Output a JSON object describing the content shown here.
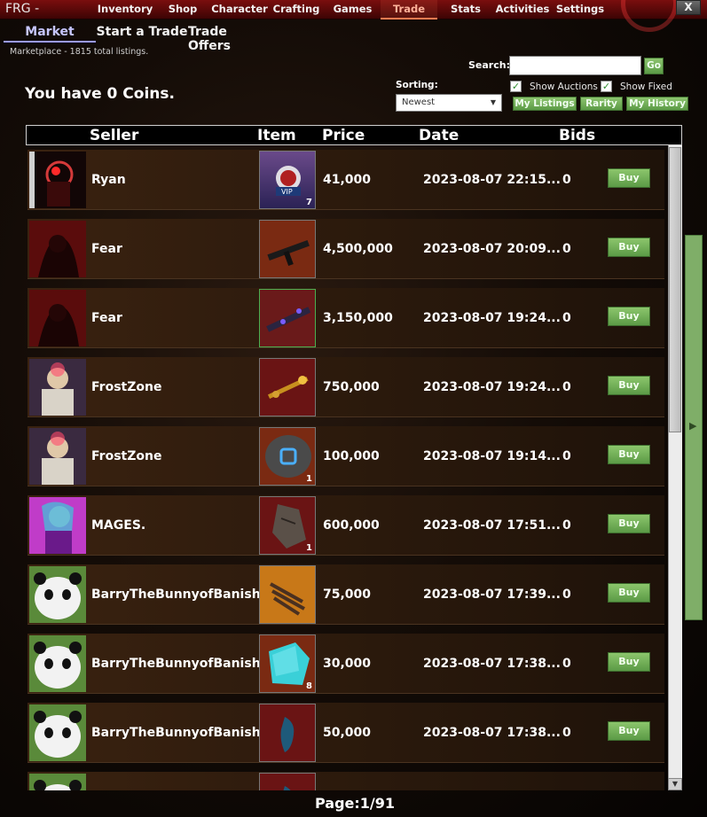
{
  "app": {
    "title": "FRG -",
    "close_label": "X"
  },
  "nav": {
    "items": [
      "Inventory",
      "Shop",
      "Character",
      "Crafting",
      "Games",
      "Trade",
      "Stats",
      "Activities",
      "Settings"
    ],
    "active": "Trade"
  },
  "subtabs": {
    "items": [
      "Market",
      "Start a Trade",
      "Trade Offers"
    ],
    "active": "Market"
  },
  "marketplace_info": "Marketplace - 1815 total listings.",
  "coins_text": "You have 0 Coins.",
  "search": {
    "label": "Search:",
    "value": "",
    "go_label": "Go"
  },
  "sorting": {
    "label": "Sorting:",
    "selected": "Newest"
  },
  "filters": {
    "show_auctions": "Show Auctions",
    "show_fixed": "Show Fixed",
    "show_auctions_checked": true,
    "show_fixed_checked": true
  },
  "buttons": {
    "my_listings": "My Listings",
    "rarity": "Rarity",
    "my_history": "My History"
  },
  "table": {
    "headers": {
      "seller": "Seller",
      "item": "Item",
      "price": "Price",
      "date": "Date",
      "bids": "Bids"
    },
    "buy_label": "Buy",
    "rows": [
      {
        "seller": "Ryan",
        "price": "41,000",
        "date": "2023-08-07 22:15...",
        "bids": "0",
        "qty": "7",
        "item_icon": "vip-badge-icon",
        "avatar": "red-robot"
      },
      {
        "seller": "Fear",
        "price": "4,500,000",
        "date": "2023-08-07 20:09...",
        "bids": "0",
        "qty": "",
        "item_icon": "smg-icon",
        "avatar": "dark-figure"
      },
      {
        "seller": "Fear",
        "price": "3,150,000",
        "date": "2023-08-07 19:24...",
        "bids": "0",
        "qty": "",
        "item_icon": "rifle-icon",
        "avatar": "dark-figure"
      },
      {
        "seller": "FrostZone",
        "price": "750,000",
        "date": "2023-08-07 19:24...",
        "bids": "0",
        "qty": "",
        "item_icon": "ornate-staff-icon",
        "avatar": "armored-mage"
      },
      {
        "seller": "FrostZone",
        "price": "100,000",
        "date": "2023-08-07 19:14...",
        "bids": "0",
        "qty": "1",
        "item_icon": "rune-stone-icon",
        "avatar": "armored-mage"
      },
      {
        "seller": "MAGES.",
        "price": "600,000",
        "date": "2023-08-07 17:51...",
        "bids": "0",
        "qty": "1",
        "item_icon": "stone-tablet-icon",
        "avatar": "anime-girl"
      },
      {
        "seller": "BarryTheBunnyofBanish...",
        "price": "75,000",
        "date": "2023-08-07 17:39...",
        "bids": "0",
        "qty": "",
        "item_icon": "claws-icon",
        "avatar": "panda"
      },
      {
        "seller": "BarryTheBunnyofBanish...",
        "price": "30,000",
        "date": "2023-08-07 17:38...",
        "bids": "0",
        "qty": "8",
        "item_icon": "crystal-cube-icon",
        "avatar": "panda"
      },
      {
        "seller": "BarryTheBunnyofBanish...",
        "price": "50,000",
        "date": "2023-08-07 17:38...",
        "bids": "0",
        "qty": "",
        "item_icon": "blue-gem-icon",
        "avatar": "panda"
      },
      {
        "seller": "",
        "price": "",
        "date": "",
        "bids": "",
        "qty": "",
        "item_icon": "blue-gem-icon",
        "avatar": "panda"
      }
    ]
  },
  "pagination": {
    "text": "Page:1/91"
  },
  "colors": {
    "accent_green": "#6fae55",
    "topbar_red": "#6b0c0c",
    "active_tab": "#ff7a50"
  }
}
